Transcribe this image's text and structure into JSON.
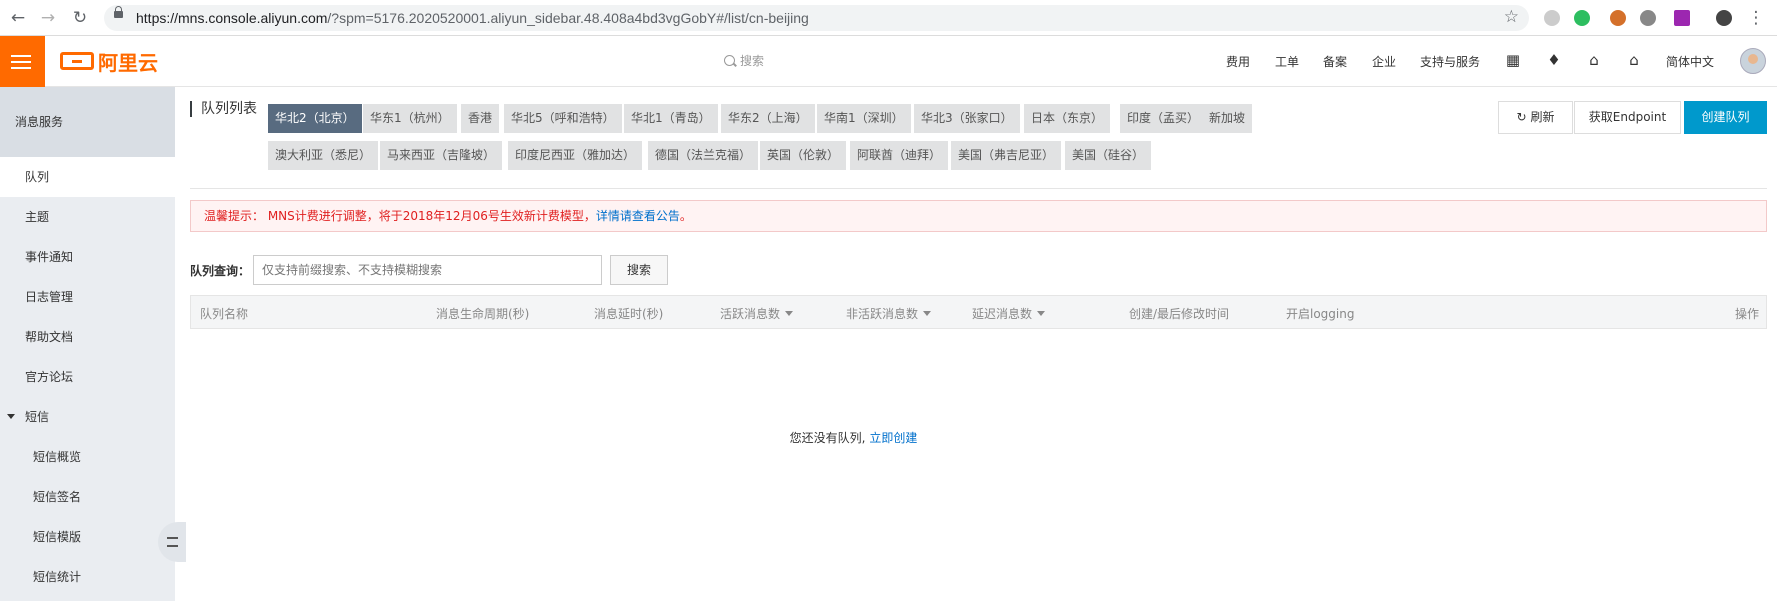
{
  "browser": {
    "url_host": "https://mns.console.aliyun.com",
    "url_path": "/?spm=5176.2020520001.aliyun_sidebar.48.408a4bd3vgGobY#/list/cn-beijing"
  },
  "header": {
    "logo_text": "阿里云",
    "search_placeholder": "搜索",
    "nav": [
      "费用",
      "工单",
      "备案",
      "企业",
      "支持与服务"
    ],
    "language": "简体中文",
    "brand_color": "#ff6a00"
  },
  "sidebar": {
    "title": "消息服务",
    "items": [
      {
        "label": "队列",
        "active": true
      },
      {
        "label": "主题"
      },
      {
        "label": "事件通知"
      },
      {
        "label": "日志管理"
      },
      {
        "label": "帮助文档"
      },
      {
        "label": "官方论坛"
      }
    ],
    "group": {
      "label": "短信",
      "children": [
        "短信概览",
        "短信签名",
        "短信模版",
        "短信统计"
      ]
    }
  },
  "main": {
    "list_title": "队列列表",
    "regions_row1": [
      "华北2（北京）",
      "华东1（杭州）",
      "香港",
      "华北5（呼和浩特）",
      "华北1（青岛）",
      "华东2（上海）",
      "华南1（深圳）",
      "华北3（张家口）",
      "日本（东京）",
      "印度（孟买）",
      "新加坡"
    ],
    "regions_row2": [
      "澳大利亚（悉尼）",
      "马来西亚（吉隆坡）",
      "印度尼西亚（雅加达）",
      "德国（法兰克福）",
      "英国（伦敦）",
      "阿联酋（迪拜）",
      "美国（弗吉尼亚）",
      "美国（硅谷）"
    ],
    "active_region": "华北2（北京）",
    "buttons": {
      "refresh": "刷新",
      "endpoint": "获取Endpoint",
      "create": "创建队列"
    },
    "notice": {
      "prefix": "温馨提示：  MNS计费进行调整，将于2018年12月06号生效新计费模型，",
      "link": "详情请查看公告",
      "suffix": "。"
    },
    "query": {
      "label": "队列查询：",
      "placeholder": "仅支持前缀搜索、不支持模糊搜索",
      "button": "搜索"
    },
    "columns": [
      "队列名称",
      "消息生命周期(秒)",
      "消息延时(秒)",
      "活跃消息数",
      "非活跃消息数",
      "延迟消息数",
      "创建/最后修改时间",
      "开启logging",
      "操作"
    ],
    "empty": {
      "text": "您还没有队列,",
      "link": "立即创建"
    }
  }
}
